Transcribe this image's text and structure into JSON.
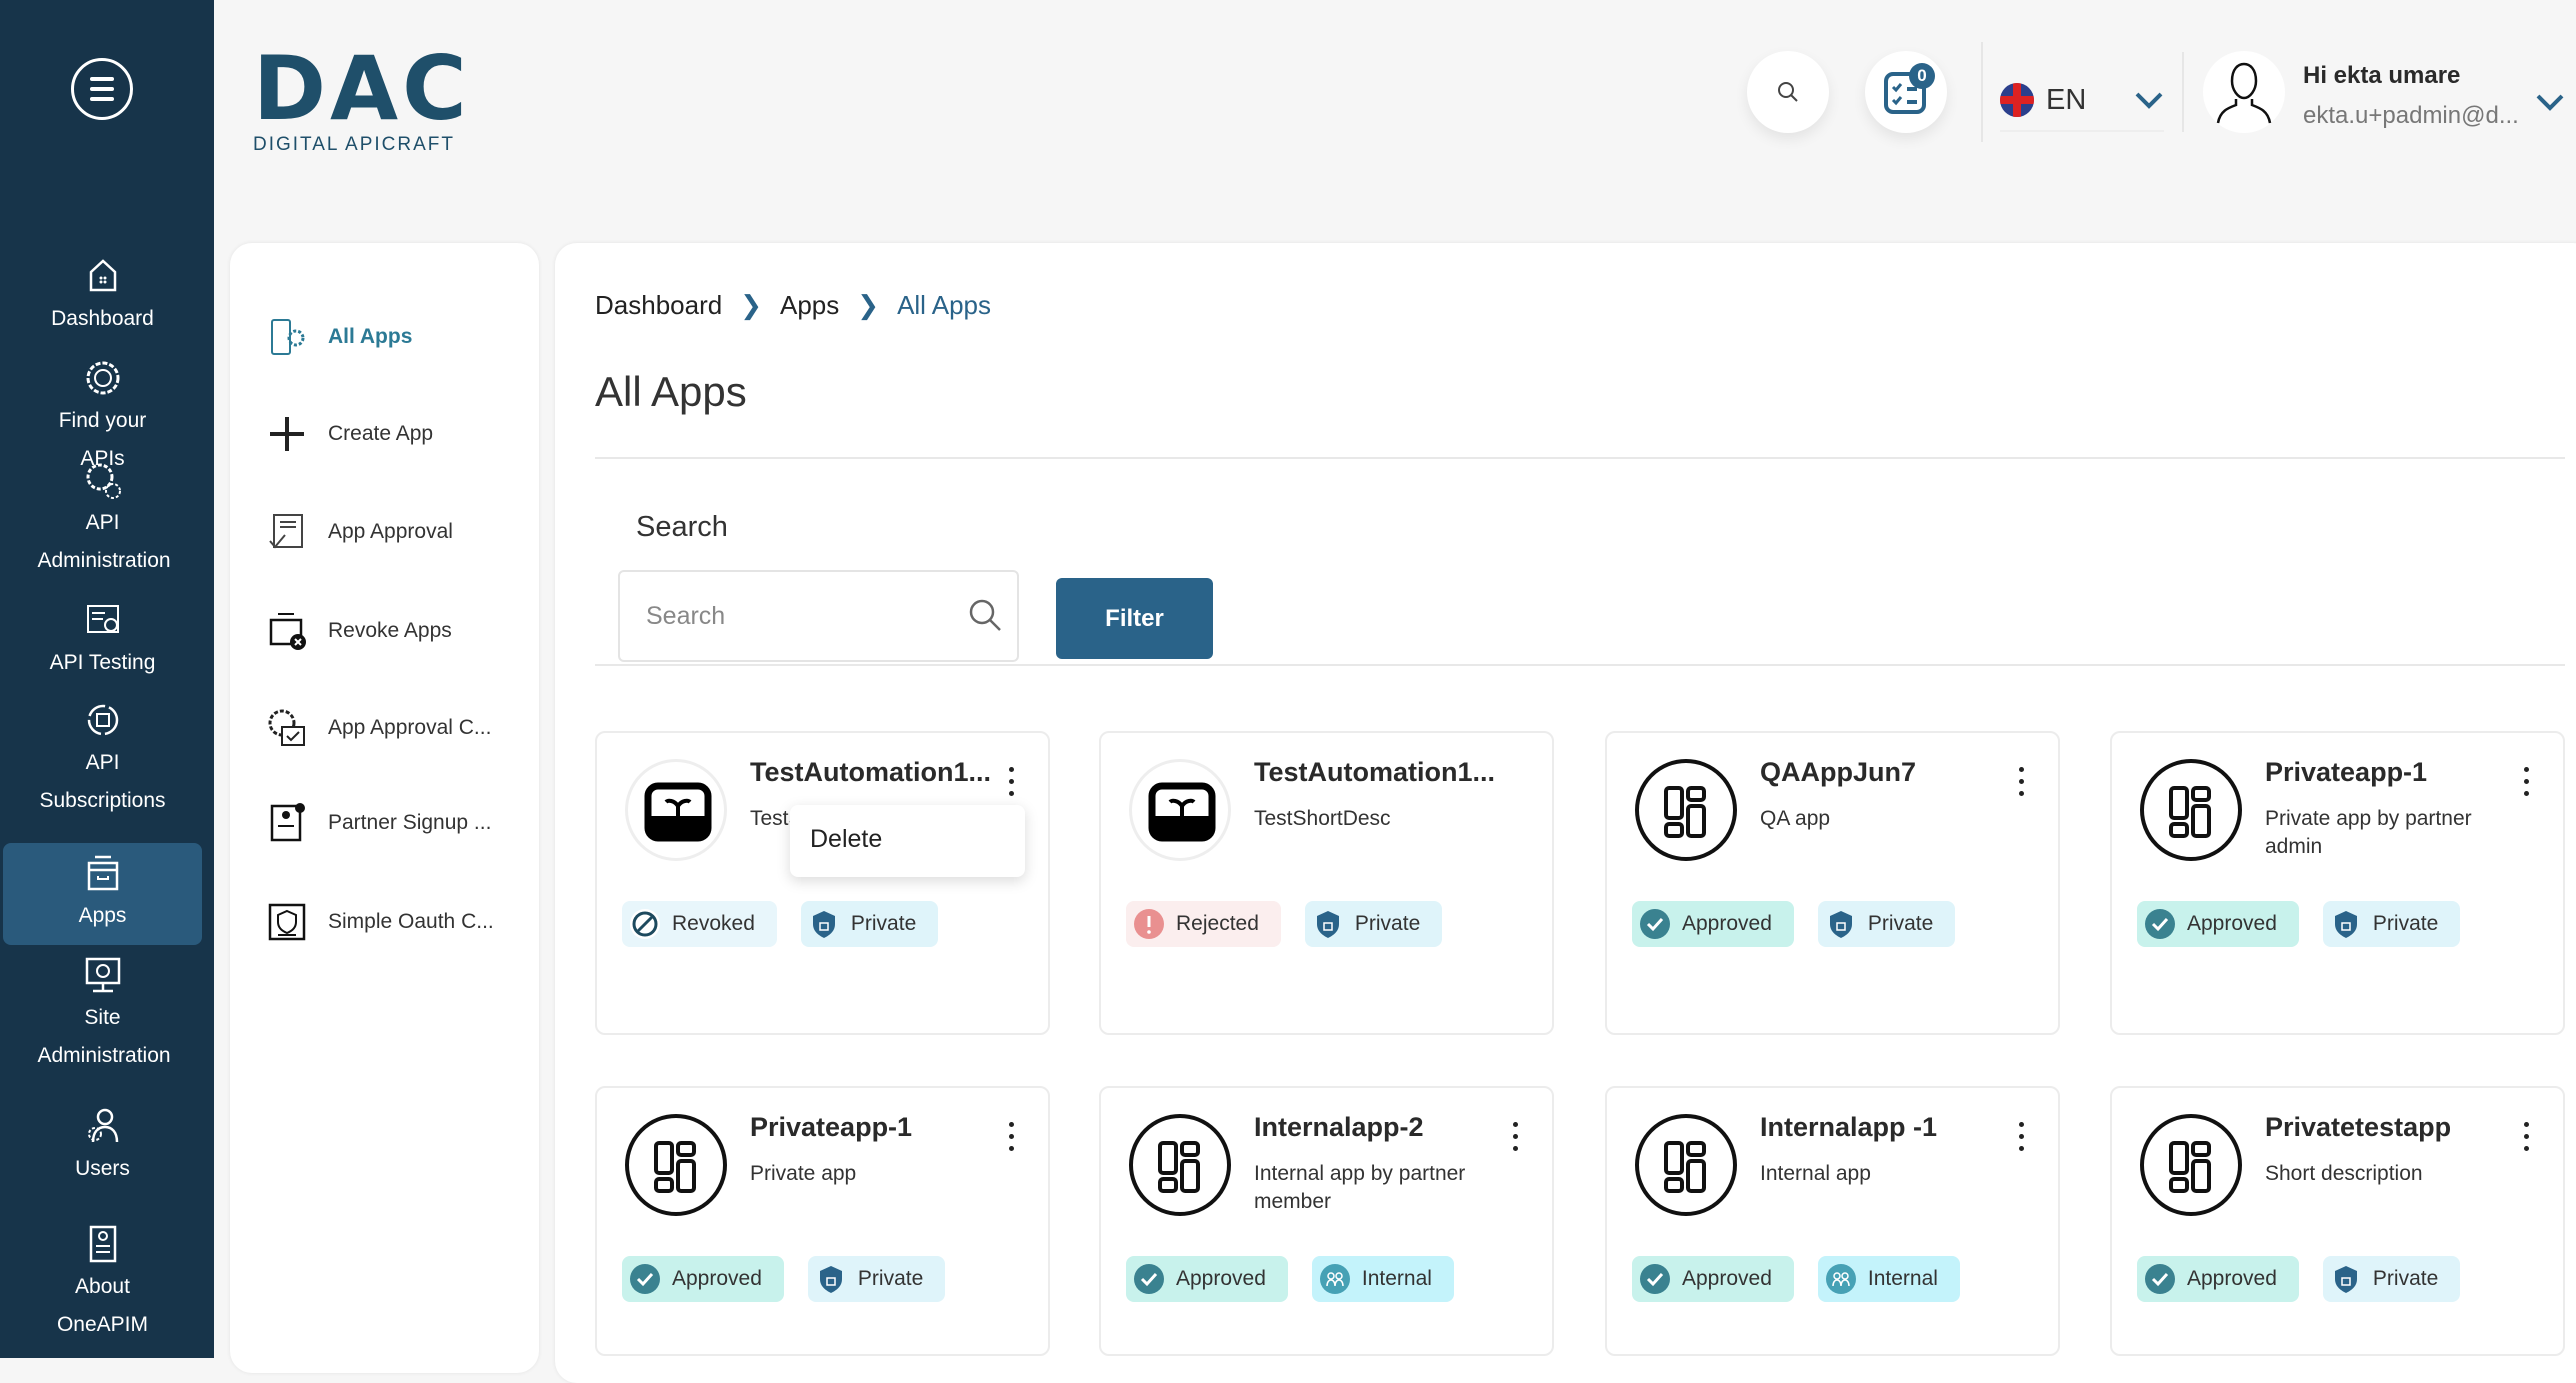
{
  "sidebar": {
    "items": [
      {
        "label": "Dashboard",
        "icon": "home-icon"
      },
      {
        "label": "Find your APIs",
        "icon": "api-gear-icon"
      },
      {
        "label": "API Administration",
        "icon": "gears-icon"
      },
      {
        "label": "API Testing",
        "icon": "testing-icon"
      },
      {
        "label": "API Subscriptions",
        "icon": "subscription-icon"
      },
      {
        "label": "Apps",
        "icon": "apps-icon",
        "active": true
      },
      {
        "label": "Site Administration",
        "icon": "site-admin-icon"
      },
      {
        "label": "Users",
        "icon": "users-icon"
      },
      {
        "label": "About OneAPIM",
        "icon": "about-icon"
      }
    ]
  },
  "logo": {
    "main": "DAC",
    "tagline": "DIGITAL APICRAFT"
  },
  "header": {
    "task_count": "0",
    "language": "EN",
    "greeting": "Hi ekta umare",
    "email": "ekta.u+padmin@d..."
  },
  "submenu": {
    "items": [
      {
        "label": "All Apps",
        "active": true
      },
      {
        "label": "Create App"
      },
      {
        "label": "App Approval"
      },
      {
        "label": "Revoke Apps"
      },
      {
        "label": "App Approval C..."
      },
      {
        "label": "Partner Signup ..."
      },
      {
        "label": "Simple Oauth C..."
      }
    ]
  },
  "breadcrumb": [
    "Dashboard",
    "Apps",
    "All Apps"
  ],
  "page_title": "All Apps",
  "search": {
    "label": "Search",
    "placeholder": "Search",
    "value": "",
    "filter_label": "Filter"
  },
  "colors": {
    "sidebar": "#17344a",
    "accent": "#2a6389"
  },
  "cards": [
    {
      "title": "TestAutomation1...",
      "desc": "TestShortDesc",
      "icon": "plant-icon",
      "status": "Revoked",
      "visibility": "Private",
      "menu": true
    },
    {
      "title": "TestAutomation1...",
      "desc": "TestShortDesc",
      "icon": "plant-icon",
      "status": "Rejected",
      "visibility": "Private",
      "menu": false
    },
    {
      "title": "QAAppJun7",
      "desc": "QA app",
      "icon": "app-layout-icon",
      "status": "Approved",
      "visibility": "Private",
      "menu": true
    },
    {
      "title": "Privateapp-1",
      "desc": "Private app by partner admin",
      "icon": "app-layout-icon",
      "status": "Approved",
      "visibility": "Private",
      "menu": true
    },
    {
      "title": "Privateapp-1",
      "desc": "Private app",
      "icon": "app-layout-icon",
      "status": "Approved",
      "visibility": "Private",
      "menu": true
    },
    {
      "title": "Internalapp-2",
      "desc": "Internal app by partner member",
      "icon": "app-layout-icon",
      "status": "Approved",
      "visibility": "Internal",
      "menu": true
    },
    {
      "title": "Internalapp -1",
      "desc": "Internal app",
      "icon": "app-layout-icon",
      "status": "Approved",
      "visibility": "Internal",
      "menu": true
    },
    {
      "title": "Privatetestapp",
      "desc": "Short description",
      "icon": "app-layout-icon",
      "status": "Approved",
      "visibility": "Private",
      "menu": true
    }
  ],
  "context_menu": {
    "item": "Delete"
  }
}
